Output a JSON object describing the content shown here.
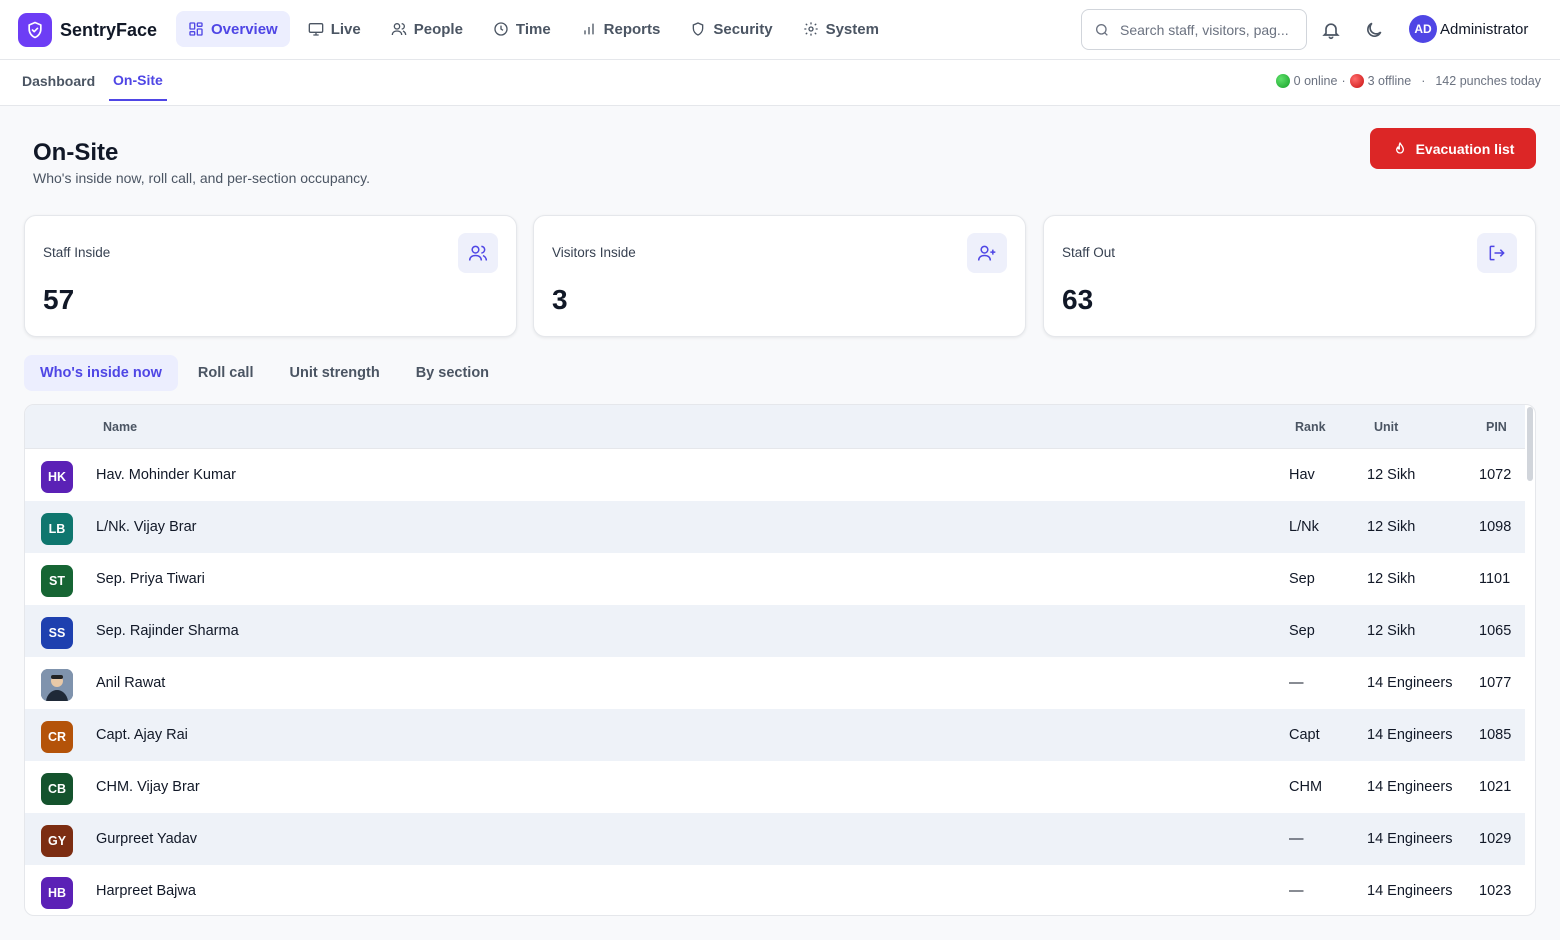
{
  "app": {
    "name": "SentryFace"
  },
  "nav": [
    {
      "label": "Overview",
      "icon": "grid-icon",
      "active": true
    },
    {
      "label": "Live",
      "icon": "monitor-icon",
      "active": false
    },
    {
      "label": "People",
      "icon": "users-icon",
      "active": false
    },
    {
      "label": "Time",
      "icon": "clock-icon",
      "active": false
    },
    {
      "label": "Reports",
      "icon": "bar-chart-icon",
      "active": false
    },
    {
      "label": "Security",
      "icon": "shield-icon",
      "active": false
    },
    {
      "label": "System",
      "icon": "gear-icon",
      "active": false
    }
  ],
  "search": {
    "placeholder": "Search staff, visitors, pag..."
  },
  "user": {
    "initials": "AD",
    "name": "Administrator"
  },
  "subtabs": [
    {
      "label": "Dashboard",
      "active": false
    },
    {
      "label": "On-Site",
      "active": true
    }
  ],
  "status": {
    "online": "0 online",
    "offline": "3 offline",
    "separator": "·",
    "punches": "142 punches today"
  },
  "page": {
    "title": "On-Site",
    "subtitle": "Who's inside now, roll call, and per-section occupancy.",
    "evac_label": "Evacuation list"
  },
  "stats": [
    {
      "label": "Staff Inside",
      "value": "57",
      "icon": "users-icon"
    },
    {
      "label": "Visitors Inside",
      "value": "3",
      "icon": "user-plus-icon"
    },
    {
      "label": "Staff Out",
      "value": "63",
      "icon": "log-out-icon"
    }
  ],
  "tabs": [
    {
      "label": "Who's inside now",
      "active": true
    },
    {
      "label": "Roll call",
      "active": false
    },
    {
      "label": "Unit strength",
      "active": false
    },
    {
      "label": "By section",
      "active": false
    }
  ],
  "table": {
    "headers": {
      "name": "Name",
      "rank": "Rank",
      "unit": "Unit",
      "pin": "PIN"
    },
    "rows": [
      {
        "initials": "HK",
        "color": "#5b21b6",
        "name": "Hav. Mohinder Kumar",
        "rank": "Hav",
        "unit": "12 Sikh",
        "pin": "1072"
      },
      {
        "initials": "LB",
        "color": "#0f766e",
        "name": "L/Nk. Vijay Brar",
        "rank": "L/Nk",
        "unit": "12 Sikh",
        "pin": "1098"
      },
      {
        "initials": "ST",
        "color": "#166534",
        "name": "Sep. Priya Tiwari",
        "rank": "Sep",
        "unit": "12 Sikh",
        "pin": "1101"
      },
      {
        "initials": "SS",
        "color": "#1e40af",
        "name": "Sep. Rajinder Sharma",
        "rank": "Sep",
        "unit": "12 Sikh",
        "pin": "1065"
      },
      {
        "initials": "",
        "color": "#6b7f99",
        "photo": true,
        "name": "Anil Rawat",
        "rank": "—",
        "unit": "14 Engineers",
        "pin": "1077"
      },
      {
        "initials": "CR",
        "color": "#b45309",
        "name": "Capt. Ajay Rai",
        "rank": "Capt",
        "unit": "14 Engineers",
        "pin": "1085"
      },
      {
        "initials": "CB",
        "color": "#14532d",
        "name": "CHM. Vijay Brar",
        "rank": "CHM",
        "unit": "14 Engineers",
        "pin": "1021"
      },
      {
        "initials": "GY",
        "color": "#7c2d12",
        "name": "Gurpreet Yadav",
        "rank": "—",
        "unit": "14 Engineers",
        "pin": "1029"
      },
      {
        "initials": "HB",
        "color": "#5b21b6",
        "name": "Harpreet Bajwa",
        "rank": "—",
        "unit": "14 Engineers",
        "pin": "1023"
      }
    ]
  }
}
